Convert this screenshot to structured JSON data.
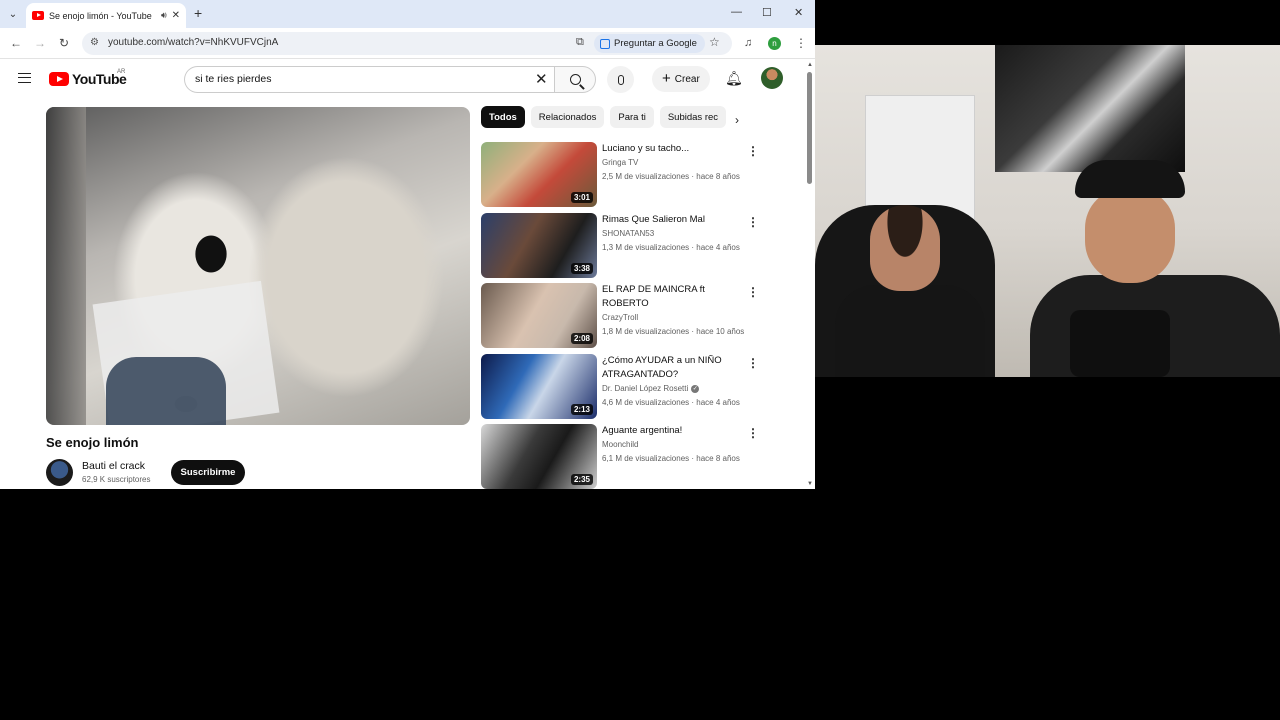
{
  "browser": {
    "tab_title": "Se enojo limón - YouTube",
    "url": "youtube.com/watch?v=NhKVUFVCjnA",
    "ask_google_label": "Preguntar a Google",
    "profile_initial": "n"
  },
  "yt": {
    "logo_text": "YouTube",
    "country_code": "AR",
    "search_query": "si te ries pierdes",
    "create_label": "Crear"
  },
  "video": {
    "title": "Se enojo limón",
    "channel": "Bauti el crack",
    "subscribers": "62,9 K suscriptores",
    "subscribe_label": "Suscribirme"
  },
  "chips": [
    "Todos",
    "Relacionados",
    "Para ti",
    "Subidas rec"
  ],
  "recommendations": [
    {
      "title": "Luciano y su tacho...",
      "channel": "Gringa TV",
      "meta": "2,5 M de visualizaciones · hace 8 años",
      "duration": "3:01",
      "verified": false
    },
    {
      "title": "Rimas Que Salieron Mal",
      "channel": "SHONATAN53",
      "meta": "1,3 M de visualizaciones · hace 4 años",
      "duration": "3:38",
      "verified": false
    },
    {
      "title": "EL RAP DE MAINCRA ft ROBERTO",
      "channel": "CrazyTroll",
      "meta": "1,8 M de visualizaciones · hace 10 años",
      "duration": "2:08",
      "verified": false
    },
    {
      "title": "¿Cómo AYUDAR a un NIÑO ATRAGANTADO?",
      "channel": "Dr. Daniel López Rosetti",
      "meta": "4,6 M de visualizaciones · hace 4 años",
      "duration": "2:13",
      "verified": true
    },
    {
      "title": "Aguante argentina!",
      "channel": "Moonchild",
      "meta": "6,1 M de visualizaciones · hace 8 años",
      "duration": "2:35",
      "verified": false
    }
  ],
  "colors": {
    "brand_red": "#ff0000",
    "tab_bar": "#dfe8f7",
    "chip_active": "#0f0f0f"
  }
}
